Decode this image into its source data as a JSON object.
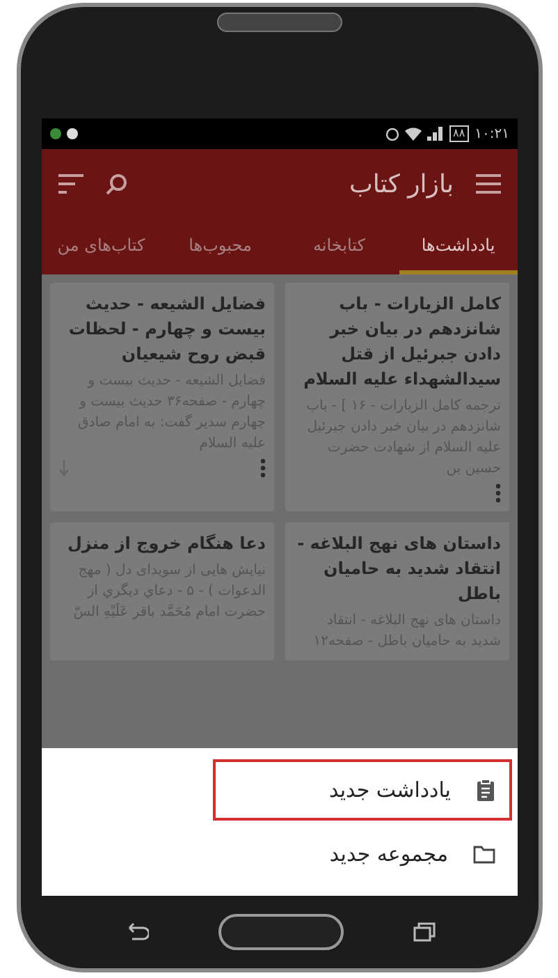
{
  "status_bar": {
    "time": "۱۰:۲۱",
    "battery": "۸۸"
  },
  "app_bar": {
    "title": "بازار کتاب"
  },
  "tabs": [
    {
      "label": "یادداشت‌ها",
      "selected": true
    },
    {
      "label": "کتابخانه",
      "selected": false
    },
    {
      "label": "محبوب‌ها",
      "selected": false
    },
    {
      "label": "کتاب‌های من",
      "selected": false
    }
  ],
  "notes": [
    {
      "title": "کامل الزیارات - باب شانزدهم در بیان خبر دادن جبرئیل از قتل سیدالشهداء علیه السلام",
      "snippet": "ترجمه کامل الزیارات - ۱۶ ] - باب شانزدهم در بیان خبر دادن جبرئیل علیه السلام از شهادت حضرت حسین بن",
      "more_menu": true,
      "pinned": false
    },
    {
      "title": "فضایل الشیعه - حدیث بیست و چهارم - لحظات قبض روح شیعیان",
      "snippet": "فضایل الشیعه - حدیث بیست و چهارم - صفحه۳۶ حدیث بیست و چهارم سدیر گفت: به امام صادق علیه السلام",
      "more_menu": true,
      "pinned": true
    },
    {
      "title": "داستان های نهج البلاغه - انتقاد شدید به حامیان باطل",
      "snippet": "داستان های نهج البلاغه - انتقاد شدید به حامیان باطل - صفحه۱۲"
    },
    {
      "title": "دعا هنگام خروج از منزل",
      "snippet": "نیایش هایی از سویدای دل ( مهج الدعوات ) - ۵ - دعاي ديگري از حضرت امام مُحَمَّد باقر عَلَيْهِ السّ"
    }
  ],
  "bottom_sheet": [
    {
      "kind": "note",
      "label": "یادداشت جدید",
      "selected": true
    },
    {
      "kind": "folder",
      "label": "مجموعه جدید",
      "selected": false
    }
  ]
}
